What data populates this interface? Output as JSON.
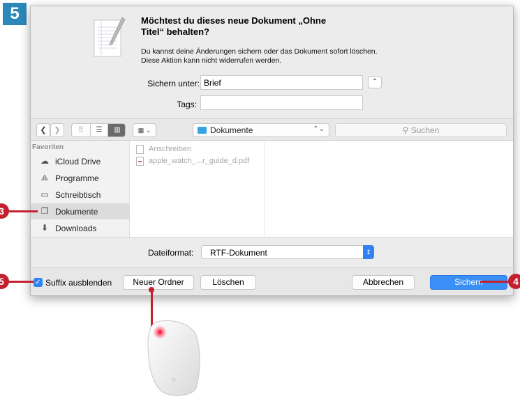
{
  "step_number": "5",
  "dialog": {
    "title": "Möchtest du dieses neue Dokument „Ohne Titel“ behalten?",
    "message": "Du kannst deine Änderungen sichern oder das Dokument sofort löschen. Diese Aktion kann nicht widerrufen werden.",
    "save_as_label": "Sichern unter:",
    "save_as_value": "Brief",
    "tags_label": "Tags:",
    "tags_value": ""
  },
  "toolbar": {
    "location": "Dokumente",
    "search_placeholder": "Suchen"
  },
  "sidebar": {
    "heading": "Favoriten",
    "items": [
      {
        "label": "iCloud Drive",
        "icon": "cloud-icon"
      },
      {
        "label": "Programme",
        "icon": "applications-icon"
      },
      {
        "label": "Schreibtisch",
        "icon": "desktop-icon"
      },
      {
        "label": "Dokumente",
        "icon": "documents-icon",
        "selected": true
      },
      {
        "label": "Downloads",
        "icon": "downloads-icon"
      }
    ]
  },
  "files": [
    {
      "name": "Anschreiben",
      "icon": "document-icon"
    },
    {
      "name": "apple_watch_...r_guide_d.pdf",
      "icon": "pdf-icon"
    }
  ],
  "format": {
    "label": "Dateiformat:",
    "value": "RTF-Dokument"
  },
  "bottom": {
    "hide_extension_label": "Suffix ausblenden",
    "hide_extension_checked": true,
    "new_folder_label": "Neuer Ordner",
    "delete_label": "Löschen",
    "cancel_label": "Abbrechen",
    "save_label": "Sichern"
  },
  "callouts": {
    "sidebar_documents": "3",
    "save_button": "4",
    "hide_extension": "5"
  },
  "colors": {
    "accent": "#2f83f5",
    "callout": "#c4202f",
    "badge": "#2b88b9"
  }
}
